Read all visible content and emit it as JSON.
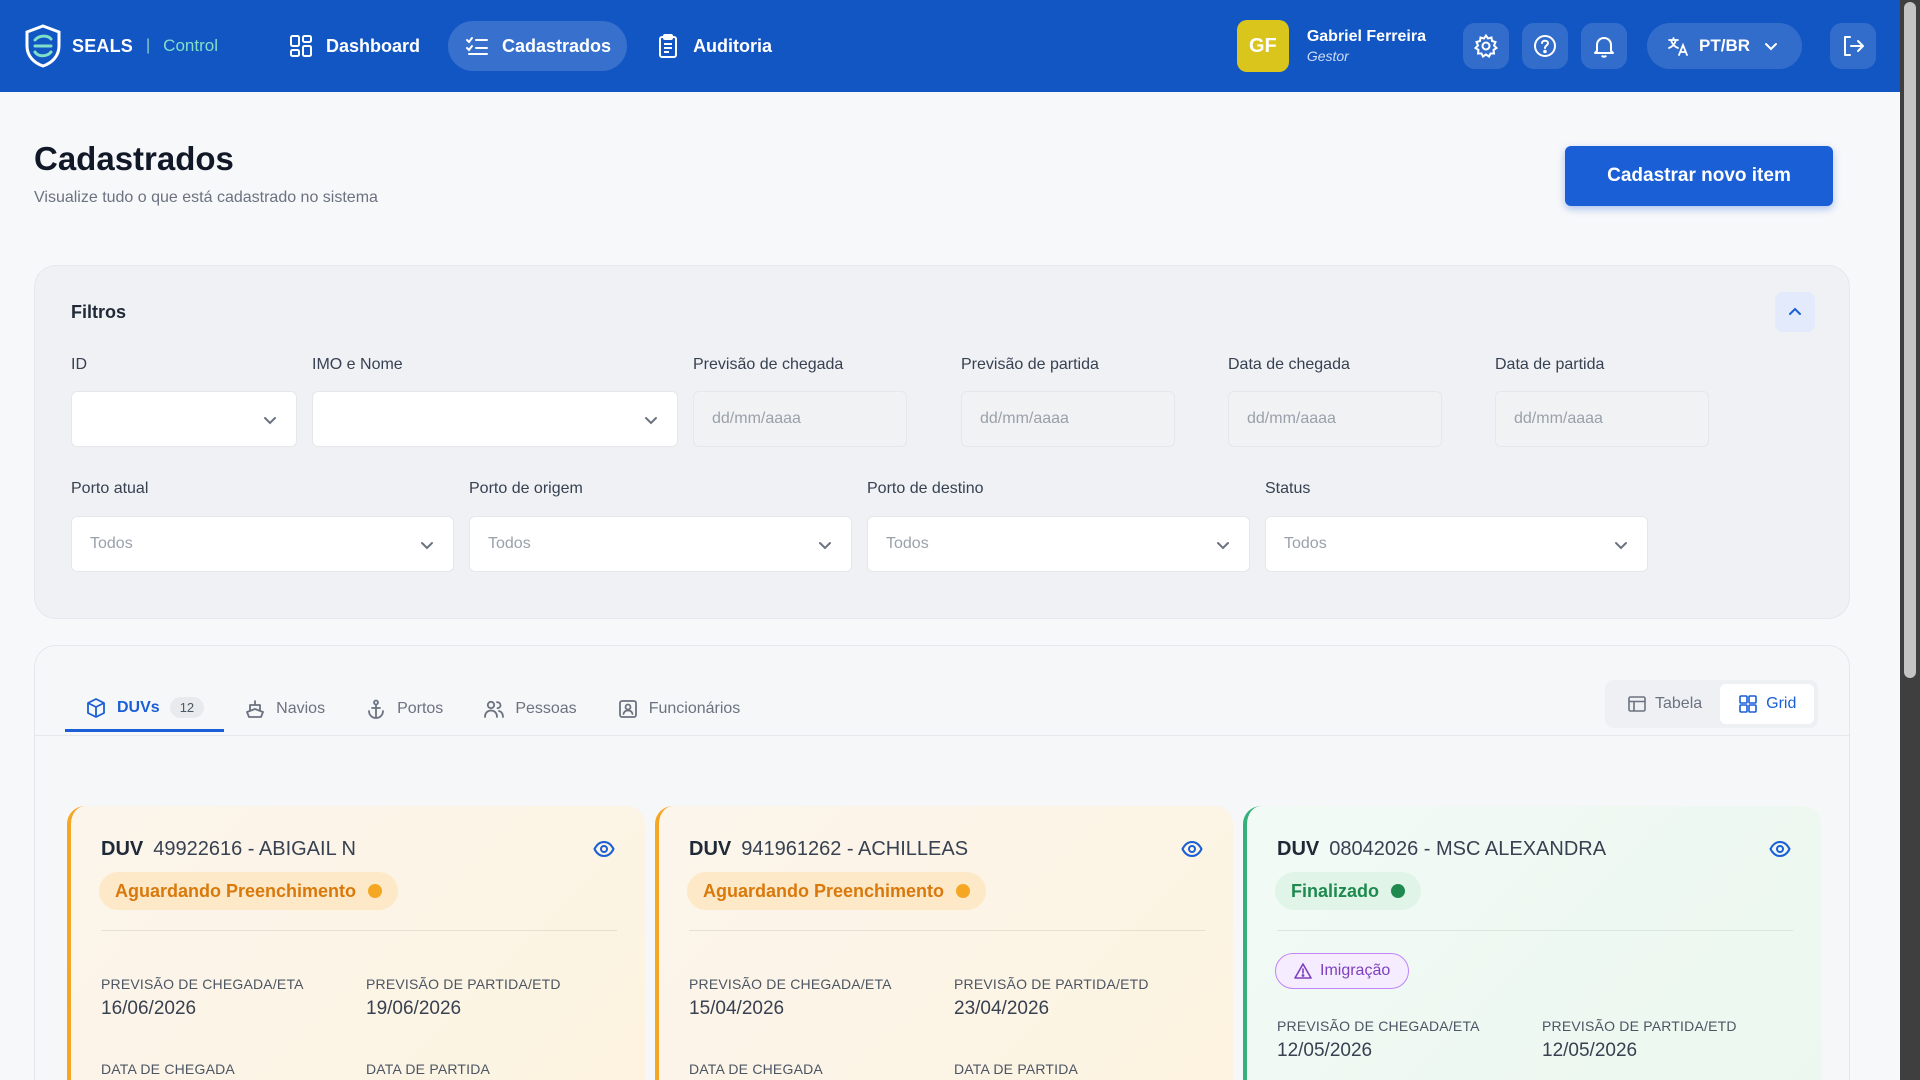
{
  "brand": {
    "name": "SEALS",
    "separator": "|",
    "product": "Control"
  },
  "nav": [
    {
      "label": "Dashboard",
      "icon": "dashboard-icon"
    },
    {
      "label": "Cadastrados",
      "icon": "list-icon"
    },
    {
      "label": "Auditoria",
      "icon": "clipboard-icon"
    }
  ],
  "user": {
    "initials": "GF",
    "name": "Gabriel Ferreira",
    "role": "Gestor"
  },
  "language": {
    "label": "PT/BR"
  },
  "page": {
    "title": "Cadastrados",
    "subtitle": "Visualize tudo o que está cadastrado no sistema",
    "primary_action": "Cadastrar novo item"
  },
  "filters": {
    "title": "Filtros",
    "id": {
      "label": "ID",
      "value": ""
    },
    "imo": {
      "label": "IMO e Nome",
      "value": ""
    },
    "eta": {
      "label": "Previsão de chegada",
      "placeholder": "dd/mm/aaaa"
    },
    "etd": {
      "label": "Previsão de partida",
      "placeholder": "dd/mm/aaaa"
    },
    "arrival": {
      "label": "Data de chegada",
      "placeholder": "dd/mm/aaaa"
    },
    "departure": {
      "label": "Data de partida",
      "placeholder": "dd/mm/aaaa"
    },
    "current_port": {
      "label": "Porto atual",
      "value": "Todos"
    },
    "origin_port": {
      "label": "Porto de origem",
      "value": "Todos"
    },
    "dest_port": {
      "label": "Porto de destino",
      "value": "Todos"
    },
    "status": {
      "label": "Status",
      "value": "Todos"
    }
  },
  "tabs": [
    {
      "label": "DUVs",
      "count": "12",
      "icon": "cube-icon"
    },
    {
      "label": "Navios",
      "icon": "ship-icon"
    },
    {
      "label": "Portos",
      "icon": "anchor-icon"
    },
    {
      "label": "Pessoas",
      "icon": "people-icon"
    },
    {
      "label": "Funcionários",
      "icon": "badge-icon"
    }
  ],
  "view": {
    "table": "Tabela",
    "grid": "Grid"
  },
  "colors": {
    "primary": "#1a5fd6",
    "topbar": "#1256c4",
    "pending": "#f5a623",
    "done": "#36b07a",
    "immigration": "#c084fc"
  },
  "cards": [
    {
      "prefix": "DUV",
      "title": "49922616 - ABIGAIL N",
      "status": "Aguardando Preenchimento",
      "eta_label": "PREVISÃO DE CHEGADA/ETA",
      "eta": "16/06/2026",
      "etd_label": "PREVISÃO DE PARTIDA/ETD",
      "etd": "19/06/2026",
      "arrival_label": "DATA DE CHEGADA",
      "departure_label": "DATA DE PARTIDA"
    },
    {
      "prefix": "DUV",
      "title": "941961262 - ACHILLEAS",
      "status": "Aguardando Preenchimento",
      "eta_label": "PREVISÃO DE CHEGADA/ETA",
      "eta": "15/04/2026",
      "etd_label": "PREVISÃO DE PARTIDA/ETD",
      "etd": "23/04/2026",
      "arrival_label": "DATA DE CHEGADA",
      "departure_label": "DATA DE PARTIDA"
    },
    {
      "prefix": "DUV",
      "title": "08042026 - MSC ALEXANDRA",
      "status": "Finalizado",
      "tag": "Imigração",
      "eta_label": "PREVISÃO DE CHEGADA/ETA",
      "eta": "12/05/2026",
      "etd_label": "PREVISÃO DE PARTIDA/ETD",
      "etd": "12/05/2026"
    }
  ]
}
